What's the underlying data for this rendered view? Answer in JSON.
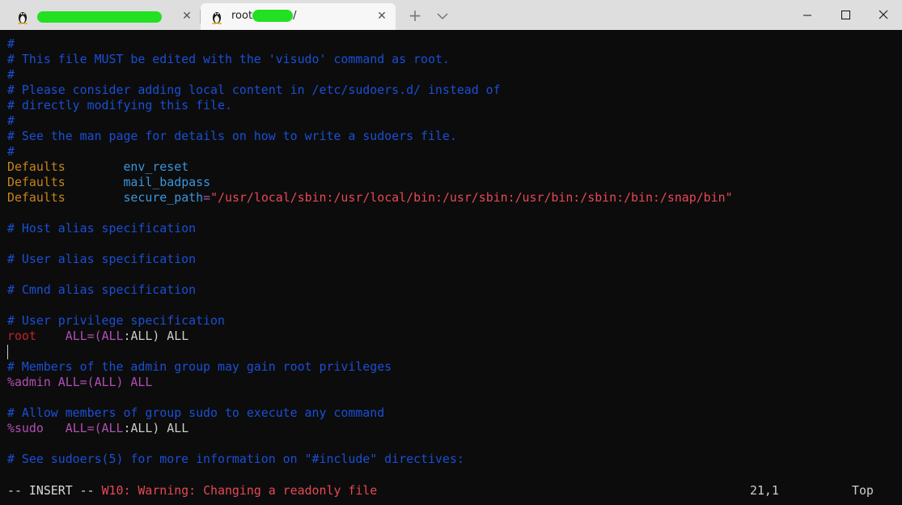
{
  "tabs": [
    {
      "title": "",
      "close": "✕",
      "icon": "linux-tux-icon"
    },
    {
      "title_prefix": "root",
      "title_suffix": "/",
      "close": "✕",
      "icon": "linux-tux-icon"
    }
  ],
  "toolbar": {
    "new_tab": "+",
    "dropdown": "chevron-down-icon"
  },
  "window_controls": [
    "minimize-icon",
    "maximize-icon",
    "close-icon"
  ],
  "file_lines": {
    "l1": "#",
    "l2": "# This file MUST be edited with the 'visudo' command as root.",
    "l3": "#",
    "l4": "# Please consider adding local content in /etc/sudoers.d/ instead of",
    "l5": "# directly modifying this file.",
    "l6": "#",
    "l7": "# See the man page for details on how to write a sudoers file.",
    "l8": "#",
    "l9_kw": "Defaults",
    "l9_val": "env_reset",
    "l10_kw": "Defaults",
    "l10_val": "mail_badpass",
    "l11_kw": "Defaults",
    "l11_key": "secure_path",
    "l11_eq": "=",
    "l11_str": "\"/usr/local/sbin:/usr/local/bin:/usr/sbin:/usr/bin:/sbin:/bin:/snap/bin\"",
    "l13": "# Host alias specification",
    "l15": "# User alias specification",
    "l17": "# Cmnd alias specification",
    "l19": "# User privilege specification",
    "l20_user": "root",
    "l20_all": "ALL=(ALL",
    "l20_colon": ":",
    "l20_rest": "ALL) ALL",
    "l22": "# Members of the admin group may gain root privileges",
    "l23_grp": "%admin",
    "l23_all": "ALL=(ALL) ALL",
    "l25": "# Allow members of group sudo to execute any command",
    "l26_grp": "%sudo",
    "l26_all": "ALL=(ALL",
    "l26_colon": ":",
    "l26_rest": "ALL) ALL",
    "l28": "# See sudoers(5) for more information on \"#include\" directives:"
  },
  "status": {
    "mode": "-- INSERT --",
    "warning": "W10: Warning: Changing a readonly file",
    "position": "21,1",
    "scroll": "Top"
  },
  "colors": {
    "comment": "#1a4fd6",
    "keyword": "#c6851d",
    "identifier": "#3a96dd",
    "string": "#e74856",
    "operator": "#b14fb4",
    "redaction": "#22e022"
  }
}
